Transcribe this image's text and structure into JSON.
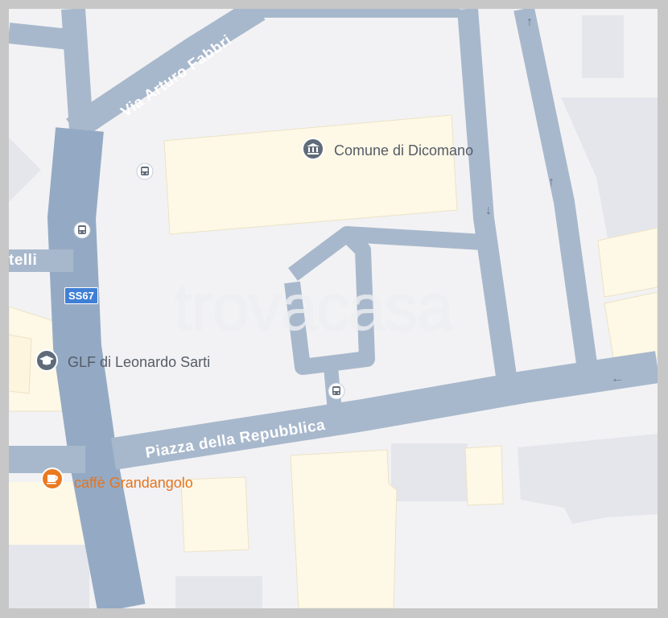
{
  "map": {
    "watermark": "trovacasa",
    "colors": {
      "road": "#a8b8cc",
      "road_major": "#94aac4",
      "building_yellow": "#fef8e6",
      "building_gray": "#e5e6ec",
      "background": "#f2f2f4",
      "poi_gray": "#5f6b78",
      "poi_orange": "#ea7a22",
      "label_text_dark": "#555c66",
      "label_text_orange": "#e5741e"
    },
    "streets": {
      "via_arturo_fabbri": "Via Arturo Fabbri",
      "piazza_della_repubblica": "Piazza della Repubblica",
      "partial_left": "telli"
    },
    "route_shield": "SS67",
    "pois": {
      "comune": {
        "name": "Comune di Dicomano",
        "icon": "town-hall-icon"
      },
      "glf": {
        "name": "GLF di Leonardo Sarti",
        "icon": "school-icon"
      },
      "caffe": {
        "name": "caffè Grandangolo",
        "icon": "cafe-icon"
      }
    },
    "bus_stop_icon": "bus-stop-icon",
    "one_way_arrows": [
      "↑",
      "↑",
      "↓",
      "←"
    ]
  }
}
